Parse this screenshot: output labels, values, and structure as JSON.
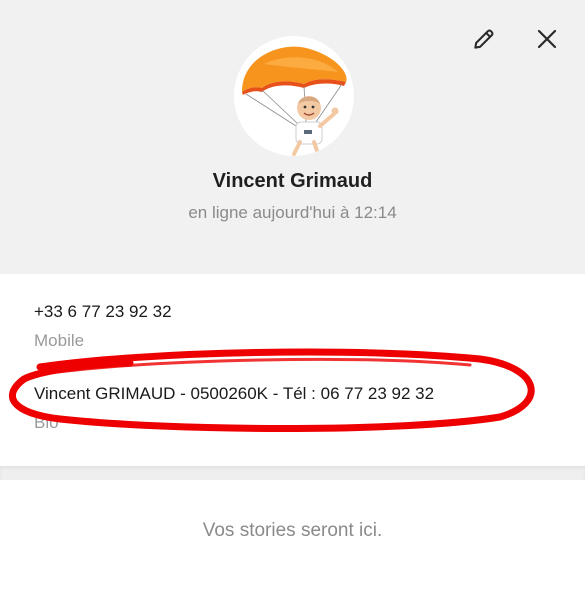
{
  "profile": {
    "name": "Vincent Grimaud",
    "status": "en ligne aujourd'hui à 12:14",
    "avatar_icon": "parachute-avatar"
  },
  "header": {
    "edit_icon": "pencil-icon",
    "close_icon": "close-icon"
  },
  "info": {
    "phone": {
      "value": "+33 6 77 23 92 32",
      "label": "Mobile"
    },
    "bio": {
      "value": "Vincent GRIMAUD - 0500260K - Tél : 06 77 23 92 32",
      "label": "Bio"
    }
  },
  "stories": {
    "empty_text": "Vos stories seront ici."
  },
  "colors": {
    "header_bg": "#f1f1f1",
    "highlight_marker": "#ee0000",
    "parachute": "#f7941d"
  }
}
